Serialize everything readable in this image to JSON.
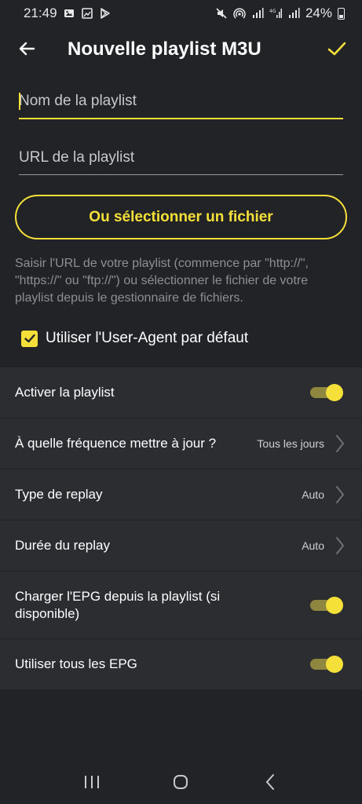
{
  "status_bar": {
    "time": "21:49",
    "left_icons": [
      "gallery-icon",
      "image-icon",
      "play-store-icon"
    ],
    "right_icons": [
      "mute-icon",
      "hotspot-icon",
      "signal-icon",
      "signal-4g-icon",
      "signal-icon"
    ],
    "battery": "24%"
  },
  "app_bar": {
    "title": "Nouvelle playlist M3U",
    "back_icon": "arrow-left-icon",
    "confirm_icon": "check-icon"
  },
  "form": {
    "name_placeholder": "Nom de la playlist",
    "url_placeholder": "URL de la playlist",
    "file_button_label": "Ou sélectionner un fichier",
    "helper_text": "Saisir l'URL de votre playlist (commence par \"http://\", \"https://\" ou \"ftp://\") ou sélectionner le fichier de votre playlist depuis le gestionnaire de fichiers.",
    "default_user_agent_label": "Utiliser l'User-Agent par défaut",
    "default_user_agent_checked": true
  },
  "settings": {
    "enable_playlist": {
      "label": "Activer la playlist",
      "on": true
    },
    "update_frequency": {
      "label": "À quelle fréquence mettre à jour ?",
      "value": "Tous les jours"
    },
    "replay_type": {
      "label": "Type de replay",
      "value": "Auto"
    },
    "replay_duration": {
      "label": "Durée du replay",
      "value": "Auto"
    },
    "load_epg": {
      "label": "Charger l'EPG depuis la playlist (si disponible)",
      "on": true
    },
    "use_all_epg": {
      "label": "Utiliser tous les EPG",
      "on": true
    }
  },
  "nav_bar": {
    "icons": [
      "recent-apps-icon",
      "home-icon",
      "back-icon"
    ]
  },
  "colors": {
    "accent": "#f5e03a",
    "background": "#222327",
    "row_background": "#2c2d31",
    "muted_text": "#8e8e94"
  }
}
